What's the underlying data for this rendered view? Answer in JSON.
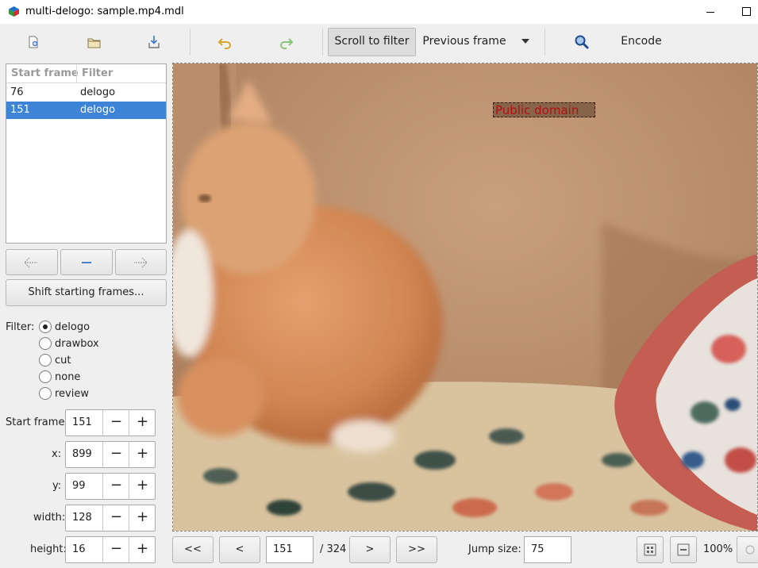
{
  "window": {
    "title": "multi-delogo: sample.mp4.mdl"
  },
  "toolbar": {
    "icons": [
      "new-file-icon",
      "open-folder-icon",
      "save-icon",
      "undo-icon",
      "redo-icon",
      "search-icon"
    ],
    "scroll_to_filter": "Scroll to filter",
    "previous_frame": "Previous frame",
    "encode": "Encode"
  },
  "table": {
    "headers": [
      "Start frame",
      "Filter"
    ],
    "rows": [
      {
        "start": "76",
        "filter": "delogo"
      },
      {
        "start": "151",
        "filter": "delogo",
        "selected": true
      }
    ]
  },
  "side": {
    "shift_label": "Shift starting frames...",
    "filter_label": "Filter:",
    "filter_options": [
      "delogo",
      "drawbox",
      "cut",
      "none",
      "review"
    ],
    "filter_selected": "delogo"
  },
  "fields": {
    "start_frame": {
      "label": "Start frame:",
      "value": "151"
    },
    "x": {
      "label": "x:",
      "value": "899"
    },
    "y": {
      "label": "y:",
      "value": "99"
    },
    "width": {
      "label": "width:",
      "value": "128"
    },
    "height": {
      "label": "height:",
      "value": "16"
    }
  },
  "video": {
    "watermark": "Public domain"
  },
  "nav": {
    "first": "<<",
    "prev": "<",
    "frame": "151",
    "total": "/ 324",
    "next": ">",
    "last": ">>",
    "jump_label": "Jump size:",
    "jump_value": "75",
    "zoom": "100%"
  },
  "colors": {
    "selection": "#3d84d6",
    "watermark_text": "#b01010"
  }
}
